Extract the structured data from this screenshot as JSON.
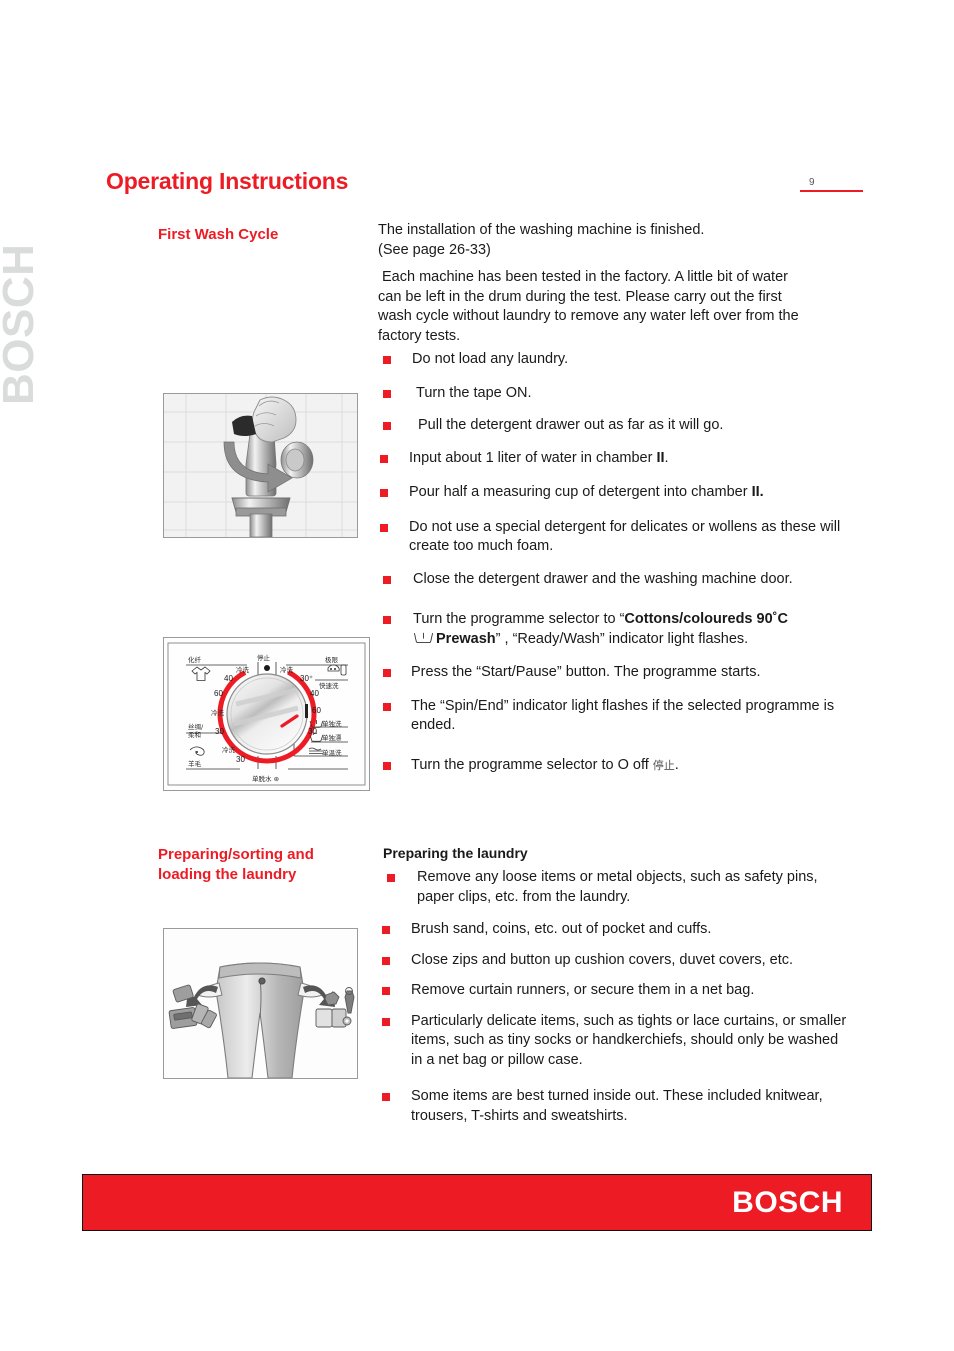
{
  "document": {
    "title": "Operating Instructions",
    "page_number": "9",
    "watermark": "BOSCH",
    "brand": "BOSCH"
  },
  "sections": [
    {
      "heading": "First Wash Cycle",
      "intro_primary": "The installation of the washing machine is finished.\n(See page 26-33)",
      "intro_secondary": "Each machine has been tested in the factory. A little bit of water can be left in the drum during the test. Please carry out the first wash cycle without laundry to remove any water left over from the factory tests.",
      "bullets": [
        "Do not load any laundry.",
        "Turn the tape ON.",
        "Pull the detergent drawer out as far as it will go.",
        "Input about 1 liter of water in chamber II.",
        "Pour half a measuring cup of detergent into chamber II.",
        "Do not use a special detergent for delicates or wollens as these will create too much foam.",
        "Close the detergent drawer and the washing machine door.",
        "Turn the programme selector to “Cottons/coloureds 90˚C  Prewash” , “Ready/Wash” indicator light flashes.",
        "Press the “Start/Pause” button. The programme starts.",
        "The “Spin/End” indicator light flashes if the selected programme is ended.",
        "Turn the programme selector to O off 停止 ."
      ],
      "bullet_rich": {
        "item_4_prefix": "Input about 1 liter of water in chamber ",
        "item_4_bold": "II",
        "item_4_suffix": ".",
        "item_5_prefix": "Pour half a measuring cup of detergent into chamber ",
        "item_5_bold": "II.",
        "item_8_line1_prefix": "Turn the programme selector to “",
        "item_8_line1_bold": "Cottons/coloureds 90˚C",
        "item_8_line2_bold": "Prewash",
        "item_8_line2_rest": "” , “Ready/Wash” indicator light flashes.",
        "item_11_prefix": "Turn the programme selector to O off ",
        "item_11_cjk": "停止",
        "item_11_suffix": "."
      }
    },
    {
      "heading": "Preparing/sorting and\nloading the laundry",
      "sub_heading": "Preparing the laundry",
      "bullets": [
        "Remove any loose items or metal objects, such as safety pins, paper clips, etc. from the laundry.",
        "Brush sand, coins, etc. out of pocket and cuffs.",
        "Close zips and button up cushion covers, duvet covers, etc.",
        "Remove curtain runners, or secure them in a net bag.",
        "Particularly delicate items, such as tights or lace curtains, or smaller items, such as tiny socks or handkerchiefs, should only be washed in a net bag or pillow case.",
        "Some items are best turned inside out. These included knitwear, trousers, T-shirts and sweatshirts."
      ]
    }
  ],
  "figures": {
    "tap": {
      "name": "hand-turning-tap-illustration",
      "caption": "Hand turning a water tap on a tiled wall with a rotation arrow"
    },
    "control_panel": {
      "name": "programme-selector-dial-illustration",
      "caption": "Washing machine programme selector dial",
      "dial_numbers_left": [
        "40",
        "60",
        "30",
        "30"
      ],
      "dial_numbers_right": [
        "30⁺",
        "40",
        "60",
        "30"
      ],
      "labels": {
        "top_left": "化纤",
        "top_center": "停止",
        "top_right": "极限",
        "right_1": "快速洗",
        "right_2": "单独洗",
        "right_3": "单独漂",
        "right_4": "单温洗",
        "left_1": "丝绸/柔和",
        "left_2": "羊毛",
        "bottom": "单脱水",
        "cold_1": "冷洗",
        "cold_2": "冷洗",
        "cold_3": "冷洗",
        "cold_4": "冷洗"
      }
    },
    "trousers": {
      "name": "emptying-trouser-pockets-illustration",
      "caption": "Trousers with pockets being emptied of coins, keys and cards"
    }
  },
  "colors": {
    "brand_red": "#ED1C24",
    "watermark_gray": "#D9DCDB",
    "text": "#1A1A1A"
  }
}
